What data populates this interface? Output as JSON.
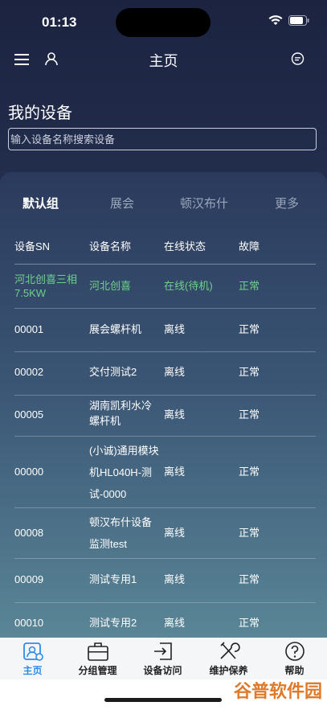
{
  "status_bar": {
    "time": "01:13"
  },
  "header": {
    "title": "主页"
  },
  "section": {
    "title": "我的设备"
  },
  "search": {
    "placeholder": "输入设备名称搜索设备"
  },
  "tabs": [
    {
      "label": "默认组",
      "active": true
    },
    {
      "label": "展会",
      "active": false
    },
    {
      "label": "顿汉布什",
      "active": false
    },
    {
      "label": "更多",
      "active": false
    }
  ],
  "table": {
    "columns": [
      "设备SN",
      "设备名称",
      "在线状态",
      "故障"
    ],
    "rows": [
      {
        "sn": "河北创喜三相7.5KW",
        "name": "河北创喜",
        "status": "在线(待机)",
        "fault": "正常",
        "highlight": true
      },
      {
        "sn": "00001",
        "name": "展会螺杆机",
        "status": "离线",
        "fault": "正常"
      },
      {
        "sn": "00002",
        "name": "交付测试2",
        "status": "离线",
        "fault": "正常"
      },
      {
        "sn": "00005",
        "name": "湖南凯利水冷螺杆机",
        "status": "离线",
        "fault": "正常"
      },
      {
        "sn": "00000",
        "name": "(小诚)通用模块机HL040H-测试-0000",
        "status": "离线",
        "fault": "正常"
      },
      {
        "sn": "00008",
        "name": "顿汉布什设备监测test",
        "status": "离线",
        "fault": "正常"
      },
      {
        "sn": "00009",
        "name": "测试专用1",
        "status": "离线",
        "fault": "正常"
      },
      {
        "sn": "00010",
        "name": "测试专用2",
        "status": "离线",
        "fault": "正常"
      }
    ]
  },
  "tabbar": [
    {
      "label": "主页",
      "icon": "home-device-icon",
      "active": true
    },
    {
      "label": "分组管理",
      "icon": "briefcase-icon"
    },
    {
      "label": "设备访问",
      "icon": "login-arrow-icon"
    },
    {
      "label": "维护保养",
      "icon": "tools-icon"
    },
    {
      "label": "帮助",
      "icon": "help-icon"
    }
  ],
  "watermark": "谷普软件园",
  "colors": {
    "accent": "#2d8cf0",
    "online": "#6fd08c"
  }
}
